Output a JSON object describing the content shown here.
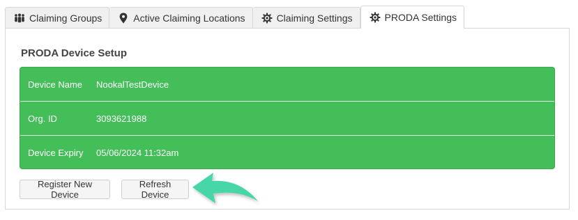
{
  "tabs": [
    {
      "label": "Claiming Groups",
      "icon": "people-group-icon",
      "active": false
    },
    {
      "label": "Active Claiming Locations",
      "icon": "map-pin-icon",
      "active": false
    },
    {
      "label": "Claiming Settings",
      "icon": "gear-icon",
      "active": false
    },
    {
      "label": "PRODA Settings",
      "icon": "gear-icon",
      "active": true
    }
  ],
  "section": {
    "title": "PRODA Device Setup"
  },
  "device": {
    "rows": [
      {
        "label": "Device Name",
        "value": "NookalTestDevice"
      },
      {
        "label": "Org. ID",
        "value": "3093621988"
      },
      {
        "label": "Device Expiry",
        "value": "05/06/2024 11:32am"
      }
    ]
  },
  "buttons": {
    "register": "Register New Device",
    "refresh": "Refresh Device"
  },
  "colors": {
    "table_bg": "#43be58",
    "arrow": "#46d6a8"
  }
}
